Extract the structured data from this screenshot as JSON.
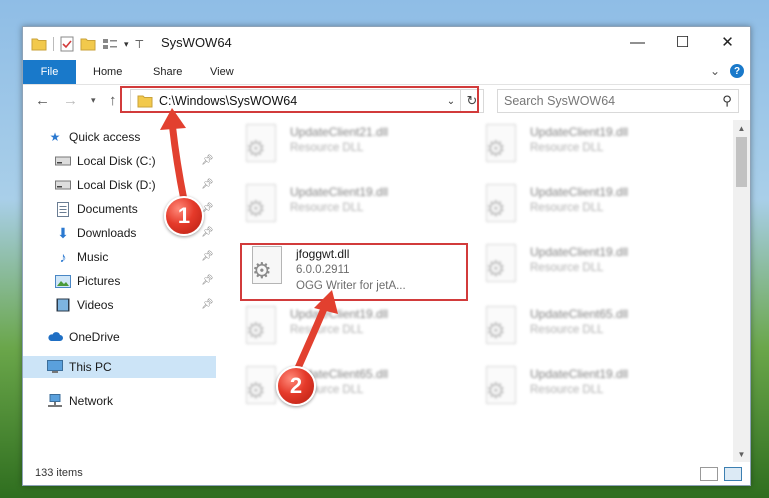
{
  "window": {
    "title": "SysWOW64",
    "minimize": "—",
    "maximize": "☐",
    "close": "✕"
  },
  "ribbon": {
    "tabs": [
      "File",
      "Home",
      "Share",
      "View"
    ],
    "collapse": "⌄",
    "help": "?"
  },
  "address": {
    "path": "C:\\Windows\\SysWOW64",
    "refresh": "↻",
    "search_placeholder": "Search SysWOW64"
  },
  "nav": {
    "items": [
      {
        "label": "Quick access",
        "icon": "star-icon",
        "pinned": false
      },
      {
        "label": "Local Disk (C:)",
        "icon": "drive-icon",
        "pinned": true
      },
      {
        "label": "Local Disk (D:)",
        "icon": "drive-icon",
        "pinned": true
      },
      {
        "label": "Documents",
        "icon": "documents-icon",
        "pinned": true
      },
      {
        "label": "Downloads",
        "icon": "downloads-icon",
        "pinned": true
      },
      {
        "label": "Music",
        "icon": "music-icon",
        "pinned": true
      },
      {
        "label": "Pictures",
        "icon": "pictures-icon",
        "pinned": true
      },
      {
        "label": "Videos",
        "icon": "videos-icon",
        "pinned": true
      },
      {
        "label": "OneDrive",
        "icon": "cloud-icon",
        "pinned": false
      },
      {
        "label": "This PC",
        "icon": "computer-icon",
        "pinned": false
      },
      {
        "label": "Network",
        "icon": "network-icon",
        "pinned": false
      }
    ]
  },
  "files": [
    {
      "name": "UpdateClient21.dll",
      "sub": "Resource DLL"
    },
    {
      "name": "UpdateClient19.dll",
      "sub": "Resource DLL"
    },
    {
      "name": "UpdateClient19.dll",
      "sub": "Resource DLL"
    },
    {
      "name": "UpdateClient19.dll",
      "sub": "Resource DLL"
    },
    {
      "name": "jfoggwt.dll",
      "version": "6.0.0.2911",
      "sub": "OGG Writer for jetA..."
    },
    {
      "name": "UpdateClient19.dll",
      "sub": "Resource DLL"
    },
    {
      "name": "UpdateClient19.dll",
      "sub": "Resource DLL"
    },
    {
      "name": "UpdateClient65.dll",
      "sub": "Resource DLL"
    },
    {
      "name": "UpdateClient65.dll",
      "sub": "Resource DLL"
    },
    {
      "name": "UpdateClient19.dll",
      "sub": "Resource DLL"
    }
  ],
  "status": {
    "count": "133 items"
  },
  "annotations": {
    "step1": "1",
    "step2": "2"
  },
  "colors": {
    "accent": "#1979ca",
    "highlight": "#d23b3b",
    "selection": "#cce4f7"
  }
}
